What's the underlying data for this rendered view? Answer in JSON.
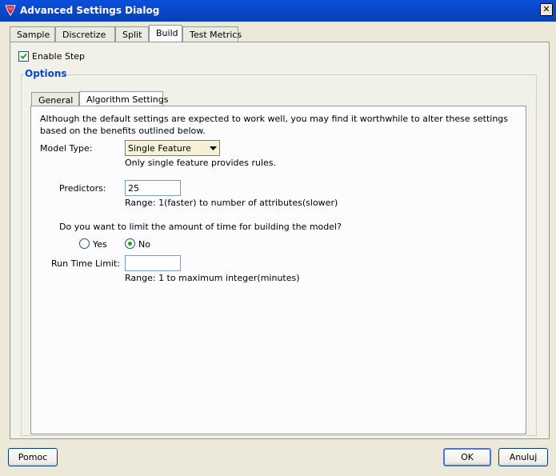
{
  "window": {
    "title": "Advanced Settings Dialog",
    "close_symbol": "✕"
  },
  "tabs": [
    {
      "label": "Sample"
    },
    {
      "label": "Discretize"
    },
    {
      "label": "Split"
    },
    {
      "label": "Build"
    },
    {
      "label": "Test Metrics"
    }
  ],
  "active_tab": "Build",
  "enable_step": {
    "label": "Enable Step",
    "checked": true
  },
  "options": {
    "legend": "Options"
  },
  "subtabs": [
    {
      "label": "General"
    },
    {
      "label": "Algorithm Settings"
    }
  ],
  "active_subtab": "Algorithm Settings",
  "settings": {
    "description": "Although the default settings are expected to work well, you may find it worthwhile to alter these settings based on the benefits outlined below.",
    "model_type": {
      "label": "Model Type:",
      "value": "Single Feature",
      "hint": "Only single feature provides rules."
    },
    "predictors": {
      "label": "Predictors:",
      "value": "25",
      "hint": "Range: 1(faster) to number of attributes(slower)"
    },
    "time_limit_question": "Do you want to limit the amount of time for building the model?",
    "radio_yes": {
      "label": "Yes",
      "selected": false
    },
    "radio_no": {
      "label": "No",
      "selected": true
    },
    "run_time_limit": {
      "label": "Run Time Limit:",
      "value": "",
      "hint": "Range: 1 to maximum integer(minutes)"
    }
  },
  "buttons": {
    "help": "Pomoc",
    "ok": "OK",
    "cancel": "Anuluj"
  },
  "colors": {
    "title_bar": "#0a4fdc",
    "legend": "#0046d5",
    "dropdown_bg": "#f6f0d8",
    "radio_dot": "#21a121"
  }
}
